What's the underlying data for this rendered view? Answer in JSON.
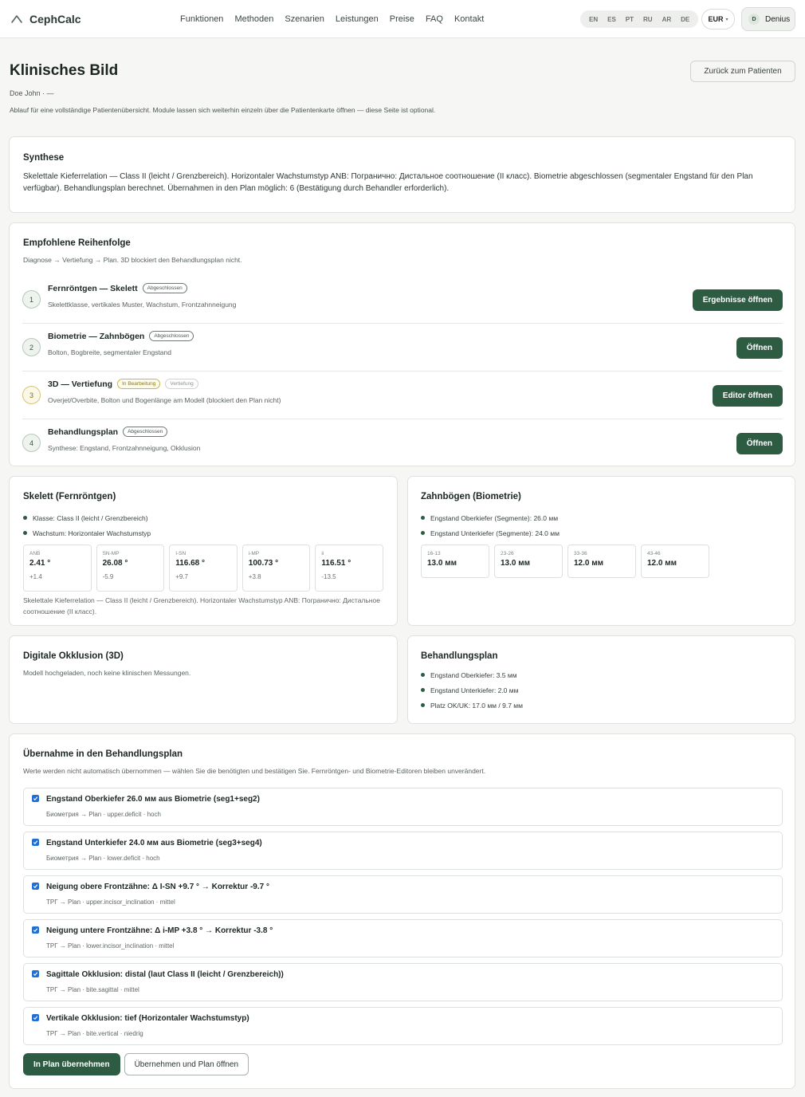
{
  "brand": {
    "name": "CephCalc",
    "icon": "logo-chevron-icon"
  },
  "nav": [
    "Funktionen",
    "Methoden",
    "Szenarien",
    "Leistungen",
    "Preise",
    "FAQ",
    "Kontakt"
  ],
  "languages": [
    "EN",
    "ES",
    "PT",
    "RU",
    "AR",
    "DE"
  ],
  "currency": {
    "value": "EUR",
    "caret": "▾"
  },
  "user": {
    "initial": "D",
    "name": "Denius"
  },
  "header": {
    "title": "Klinisches Bild",
    "patient": "Doe John · —",
    "intro": "Ablauf für eine vollständige Patientenübersicht. Module lassen sich weiterhin einzeln über die Patientenkarte öffnen — diese Seite ist optional.",
    "back_label": "Zurück zum Patienten"
  },
  "synthese": {
    "title": "Synthese",
    "text": "Skelettale Kieferrelation — Class II (leicht / Grenzbereich). Horizontaler Wachstumstyp ANB: Погранично: Дистальное соотношение (II класс). Biometrie abgeschlossen (segmentaler Engstand für den Plan verfügbar). Behandlungsplan berechnet. Übernahmen in den Plan möglich: 6 (Bestätigung durch Behandler erforderlich)."
  },
  "steps": {
    "title": "Empfohlene Reihenfolge",
    "subtitle": "Diagnose → Vertiefung → Plan. 3D blockiert den Behandlungsplan nicht.",
    "items": [
      {
        "num": "1",
        "title": "Fernröntgen — Skelett",
        "badge": "Abgeschlossen",
        "tag": "",
        "desc": "Skelettklasse, vertikales Muster, Wachstum, Frontzahnneigung",
        "button": "Ergebnisse öffnen"
      },
      {
        "num": "2",
        "title": "Biometrie — Zahnbögen",
        "badge": "Abgeschlossen",
        "tag": "",
        "desc": "Bolton, Bogbreite, segmentaler Engstand",
        "button": "Öffnen"
      },
      {
        "num": "3",
        "title": "3D — Vertiefung",
        "badge": "In Bearbeitung",
        "tag": "Vertiefung",
        "desc": "Overjet/Overbite, Bolton und Bogenlänge am Modell (blockiert den Plan nicht)",
        "button": "Editor öffnen"
      },
      {
        "num": "4",
        "title": "Behandlungsplan",
        "badge": "Abgeschlossen",
        "tag": "",
        "desc": "Synthese: Engstand, Frontzahnneigung, Okklusion",
        "button": "Öffnen"
      }
    ]
  },
  "skelett": {
    "title": "Skelett (Fernröntgen)",
    "bullets": [
      "Klasse: Class II (leicht / Grenzbereich)",
      "Wachstum: Horizontaler Wachstumstyp"
    ],
    "tiles": [
      {
        "label": "ANB",
        "value": "2.41 °",
        "delta": "+1.4"
      },
      {
        "label": "SN-MP",
        "value": "26.08 °",
        "delta": "-5.9"
      },
      {
        "label": "I-SN",
        "value": "116.68 °",
        "delta": "+9.7"
      },
      {
        "label": "i-MP",
        "value": "100.73 °",
        "delta": "+3.8"
      },
      {
        "label": "ii",
        "value": "116.51 °",
        "delta": "-13.5"
      }
    ],
    "foot": "Skelettale Kieferrelation — Class II (leicht / Grenzbereich). Horizontaler Wachstumstyp ANB: Погранично: Дистальное соотношение (II класс)."
  },
  "zahnboegen": {
    "title": "Zahnbögen (Biometrie)",
    "bullets": [
      "Engstand Oberkiefer (Segmente): 26.0 мм",
      "Engstand Unterkiefer (Segmente): 24.0 мм"
    ],
    "tiles": [
      {
        "label": "16-13",
        "value": "13.0 мм"
      },
      {
        "label": "23-26",
        "value": "13.0 мм"
      },
      {
        "label": "33-36",
        "value": "12.0 мм"
      },
      {
        "label": "43-46",
        "value": "12.0 мм"
      }
    ]
  },
  "okklusion": {
    "title": "Digitale Okklusion (3D)",
    "text": "Modell hochgeladen, noch keine klinischen Messungen."
  },
  "plan": {
    "title": "Behandlungsplan",
    "bullets": [
      "Engstand Oberkiefer: 3.5 мм",
      "Engstand Unterkiefer: 2.0 мм",
      "Platz OK/UK: 17.0 мм / 9.7 мм"
    ]
  },
  "transfer": {
    "title": "Übernahme in den Behandlungsplan",
    "subtitle": "Werte werden nicht automatisch übernommen — wählen Sie die benötigten und bestätigen Sie. Fernröntgen- und Biometrie-Editoren bleiben unverändert.",
    "items": [
      {
        "title": "Engstand Oberkiefer 26.0 мм aus Biometrie (seg1+seg2)",
        "meta": "Биометрия → Plan · upper.deficit · hoch"
      },
      {
        "title": "Engstand Unterkiefer 24.0 мм aus Biometrie (seg3+seg4)",
        "meta": "Биометрия → Plan · lower.deficit · hoch"
      },
      {
        "title": "Neigung obere Frontzähne: Δ I-SN +9.7 ° → Korrektur -9.7 °",
        "meta": "ТРГ → Plan · upper.incisor_inclination · mittel"
      },
      {
        "title": "Neigung untere Frontzähne: Δ i-MP +3.8 ° → Korrektur -3.8 °",
        "meta": "ТРГ → Plan · lower.incisor_inclination · mittel"
      },
      {
        "title": "Sagittale Okklusion: distal (laut Class II (leicht / Grenzbereich))",
        "meta": "ТРГ → Plan · bite.sagittal · mittel"
      },
      {
        "title": "Vertikale Okklusion: tief (Horizontaler Wachstumstyp)",
        "meta": "ТРГ → Plan · bite.vertical · niedrig"
      }
    ],
    "primary_label": "In Plan übernehmen",
    "secondary_label": "Übernehmen und Plan öffnen"
  },
  "colors": {
    "accent": "#2d5c43",
    "checkbox": "#1f6fd6",
    "progress": "#c8b74e"
  }
}
